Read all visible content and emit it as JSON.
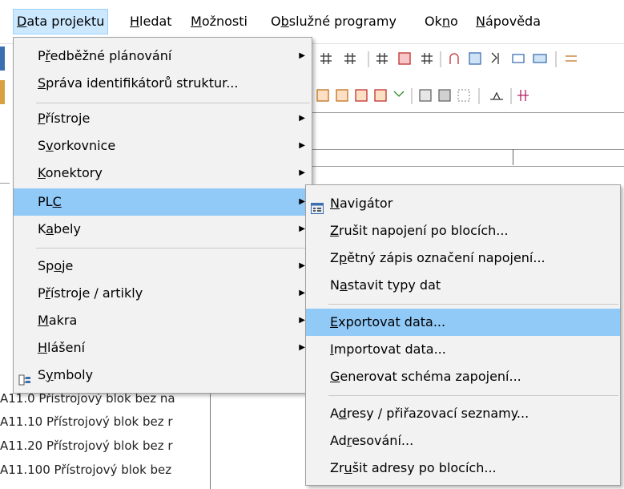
{
  "menubar": {
    "items": [
      {
        "id": "data",
        "pre": "",
        "ul": "D",
        "post": "ata projektu",
        "active": true
      },
      {
        "id": "hledat",
        "pre": "",
        "ul": "H",
        "post": "ledat",
        "active": false
      },
      {
        "id": "moznosti",
        "pre": "",
        "ul": "M",
        "post": "ožnosti",
        "active": false
      },
      {
        "id": "obsluzne",
        "pre": "O",
        "ul": "b",
        "post": "služné programy",
        "active": false
      },
      {
        "id": "okno",
        "pre": "Ok",
        "ul": "n",
        "post": "o",
        "active": false
      },
      {
        "id": "napoveda",
        "pre": "",
        "ul": "N",
        "post": "ápověda",
        "active": false
      }
    ]
  },
  "main_menu": {
    "items": [
      {
        "pre": "P",
        "ul": "ř",
        "post": "edběžné plánování",
        "submenu": true
      },
      {
        "pre": "",
        "ul": "S",
        "post": "práva identifikátorů struktur...",
        "submenu": false
      },
      {
        "pre": "",
        "ul": "P",
        "post": "řístroje",
        "submenu": true
      },
      {
        "pre": "S",
        "ul": "v",
        "post": "orkovnice",
        "submenu": true
      },
      {
        "pre": "",
        "ul": "K",
        "post": "onektory",
        "submenu": true
      },
      {
        "pre": "PL",
        "ul": "C",
        "post": "",
        "submenu": true,
        "highlight": true
      },
      {
        "pre": "K",
        "ul": "a",
        "post": "bely",
        "submenu": true
      },
      {
        "pre": "Sp",
        "ul": "o",
        "post": "je",
        "submenu": true
      },
      {
        "pre": "P",
        "ul": "ř",
        "post": "ístroje / artikly",
        "submenu": true
      },
      {
        "pre": "",
        "ul": "M",
        "post": "akra",
        "submenu": true
      },
      {
        "pre": "",
        "ul": "H",
        "post": "lášení",
        "submenu": true
      },
      {
        "pre": "S",
        "ul": "y",
        "post": "mboly",
        "submenu": false,
        "icon": "symbols-icon"
      }
    ]
  },
  "plc_menu": {
    "items": [
      {
        "pre": "",
        "ul": "N",
        "post": "avigátor",
        "icon": "navigator-icon"
      },
      {
        "pre": "",
        "ul": "Z",
        "post": "rušit napojení po blocích..."
      },
      {
        "pre": "Z",
        "ul": "p",
        "post": "ětný zápis označení napojení..."
      },
      {
        "pre": "N",
        "ul": "a",
        "post": "stavit typy dat"
      },
      {
        "pre": "",
        "ul": "E",
        "post": "xportovat data...",
        "highlight": true
      },
      {
        "pre": "",
        "ul": "I",
        "post": "mportovat data..."
      },
      {
        "pre": "",
        "ul": "G",
        "post": "enerovat schéma zapojení..."
      },
      {
        "pre": "A",
        "ul": "d",
        "post": "resy / přiřazovací seznamy..."
      },
      {
        "pre": "Ad",
        "ul": "r",
        "post": "esování..."
      },
      {
        "pre": "Zr",
        "ul": "u",
        "post": "šit adresy po blocích..."
      }
    ]
  },
  "background_list": [
    "A11.0 Přístrojový blok bez na",
    "A11.10 Přístrojový blok bez r",
    "A11.20 Přístrojový blok bez r",
    "A11.100 Přístrojový blok bez"
  ],
  "colors": {
    "menu_bg": "#f2f2f2",
    "highlight": "#91c9f7",
    "menubar_active": "#cce8ff"
  }
}
